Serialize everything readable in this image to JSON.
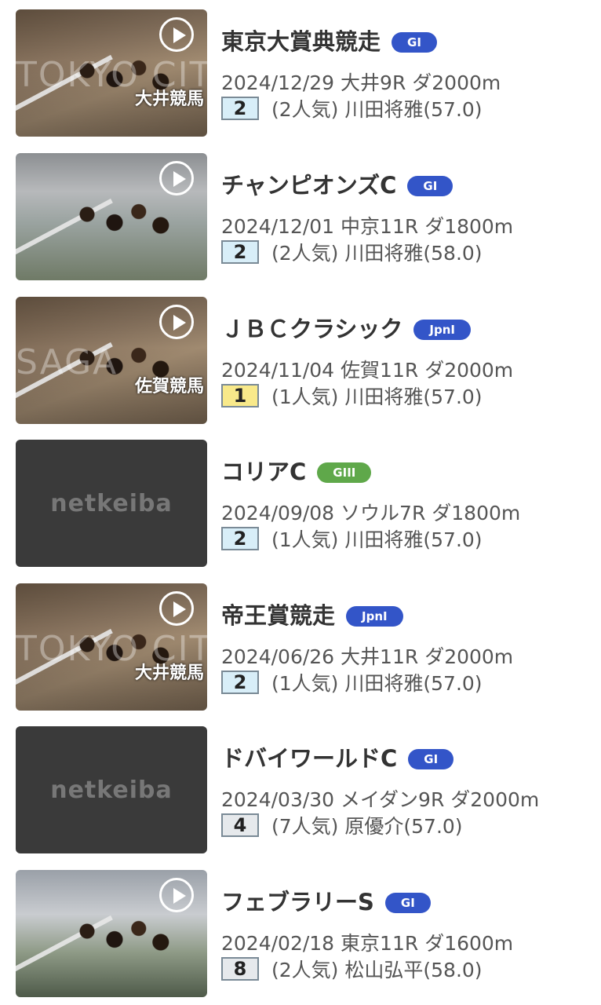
{
  "races": [
    {
      "title": "東京大賞典競走",
      "grade": "GI",
      "grade_color": "#3355c8",
      "date": "2024/12/29",
      "venue_race": "大井9R",
      "course": "ダ2000m",
      "rank": "2",
      "rank_bg": "#d8eef8",
      "popularity": "(2人気)",
      "jockey": "川田将雅(57.0)",
      "thumb": "video",
      "thumb_watermark": "TOKYO CITY KEIBA",
      "thumb_venue": "大井競馬"
    },
    {
      "title": "チャンピオンズC",
      "grade": "GI",
      "grade_color": "#3355c8",
      "date": "2024/12/01",
      "venue_race": "中京11R",
      "course": "ダ1800m",
      "rank": "2",
      "rank_bg": "#d8eef8",
      "popularity": "(2人気)",
      "jockey": "川田将雅(58.0)",
      "thumb": "gate",
      "thumb_watermark": "",
      "thumb_venue": ""
    },
    {
      "title": "ＪＢＣクラシック",
      "grade": "JpnI",
      "grade_color": "#3355c8",
      "date": "2024/11/04",
      "venue_race": "佐賀11R",
      "course": "ダ2000m",
      "rank": "1",
      "rank_bg": "#f8e98a",
      "popularity": "(1人気)",
      "jockey": "川田将雅(57.0)",
      "thumb": "video",
      "thumb_watermark": "SAGA",
      "thumb_venue": "佐賀競馬"
    },
    {
      "title": "コリアC",
      "grade": "GIII",
      "grade_color": "#5fa84a",
      "date": "2024/09/08",
      "venue_race": "ソウル7R",
      "course": "ダ1800m",
      "rank": "2",
      "rank_bg": "#d8eef8",
      "popularity": "(1人気)",
      "jockey": "川田将雅(57.0)",
      "thumb": "placeholder",
      "thumb_logo": "netkeiba"
    },
    {
      "title": "帝王賞競走",
      "grade": "JpnI",
      "grade_color": "#3355c8",
      "date": "2024/06/26",
      "venue_race": "大井11R",
      "course": "ダ2000m",
      "rank": "2",
      "rank_bg": "#d8eef8",
      "popularity": "(1人気)",
      "jockey": "川田将雅(57.0)",
      "thumb": "video",
      "thumb_watermark": "TOKYO CITY KEIBA",
      "thumb_venue": "大井競馬"
    },
    {
      "title": "ドバイワールドC",
      "grade": "GI",
      "grade_color": "#3355c8",
      "date": "2024/03/30",
      "venue_race": "メイダン9R",
      "course": "ダ2000m",
      "rank": "4",
      "rank_bg": "#e6e9ec",
      "popularity": "(7人気)",
      "jockey": "原優介(57.0)",
      "thumb": "placeholder",
      "thumb_logo": "netkeiba"
    },
    {
      "title": "フェブラリーS",
      "grade": "GI",
      "grade_color": "#3355c8",
      "date": "2024/02/18",
      "venue_race": "東京11R",
      "course": "ダ1600m",
      "rank": "8",
      "rank_bg": "#e6e9ec",
      "popularity": "(2人気)",
      "jockey": "松山弘平(58.0)",
      "thumb": "gate2",
      "thumb_watermark": "",
      "thumb_venue": ""
    }
  ]
}
